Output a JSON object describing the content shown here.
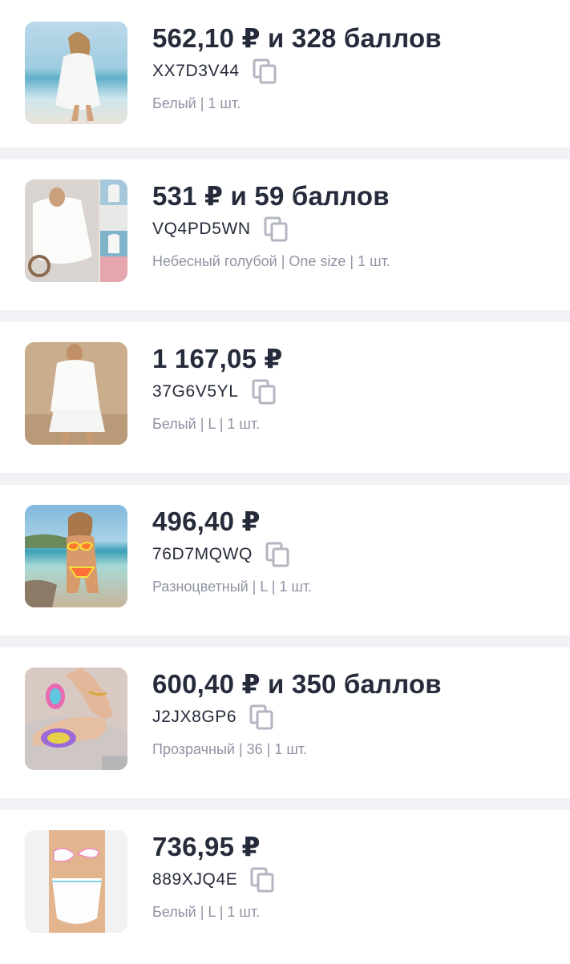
{
  "orders": [
    {
      "price": "562,10 ₽ и 328 баллов",
      "code": "XX7D3V44",
      "meta": "Белый | 1 шт.",
      "image": "beach-tunic-photo"
    },
    {
      "price": "531 ₽ и 59 баллов",
      "code": "VQ4PD5WN",
      "meta": "Небесный голубой | One size | 1 шт.",
      "image": "white-blouse-collage-photo"
    },
    {
      "price": "1 167,05 ₽",
      "code": "37G6V5YL",
      "meta": "Белый | L | 1 шт.",
      "image": "white-shirt-shorts-set-photo"
    },
    {
      "price": "496,40 ₽",
      "code": "76D7MQWQ",
      "meta": "Разноцветный | L | 1 шт.",
      "image": "bikini-beach-photo"
    },
    {
      "price": "600,40 ₽ и 350 баллов",
      "code": "J2JX8GP6",
      "meta": "Прозрачный | 36 | 1 шт.",
      "image": "sandals-photo"
    },
    {
      "price": "736,95 ₽",
      "code": "889XJQ4E",
      "meta": "Белый | L | 1 шт.",
      "image": "white-swimsuit-photo"
    }
  ],
  "icons": {
    "copy": "copy-icon"
  },
  "colors": {
    "background": "#f1f2f5",
    "card": "#ffffff",
    "text_primary": "#262b3b",
    "text_secondary": "#8f93a3",
    "icon": "#b3b6c1"
  }
}
